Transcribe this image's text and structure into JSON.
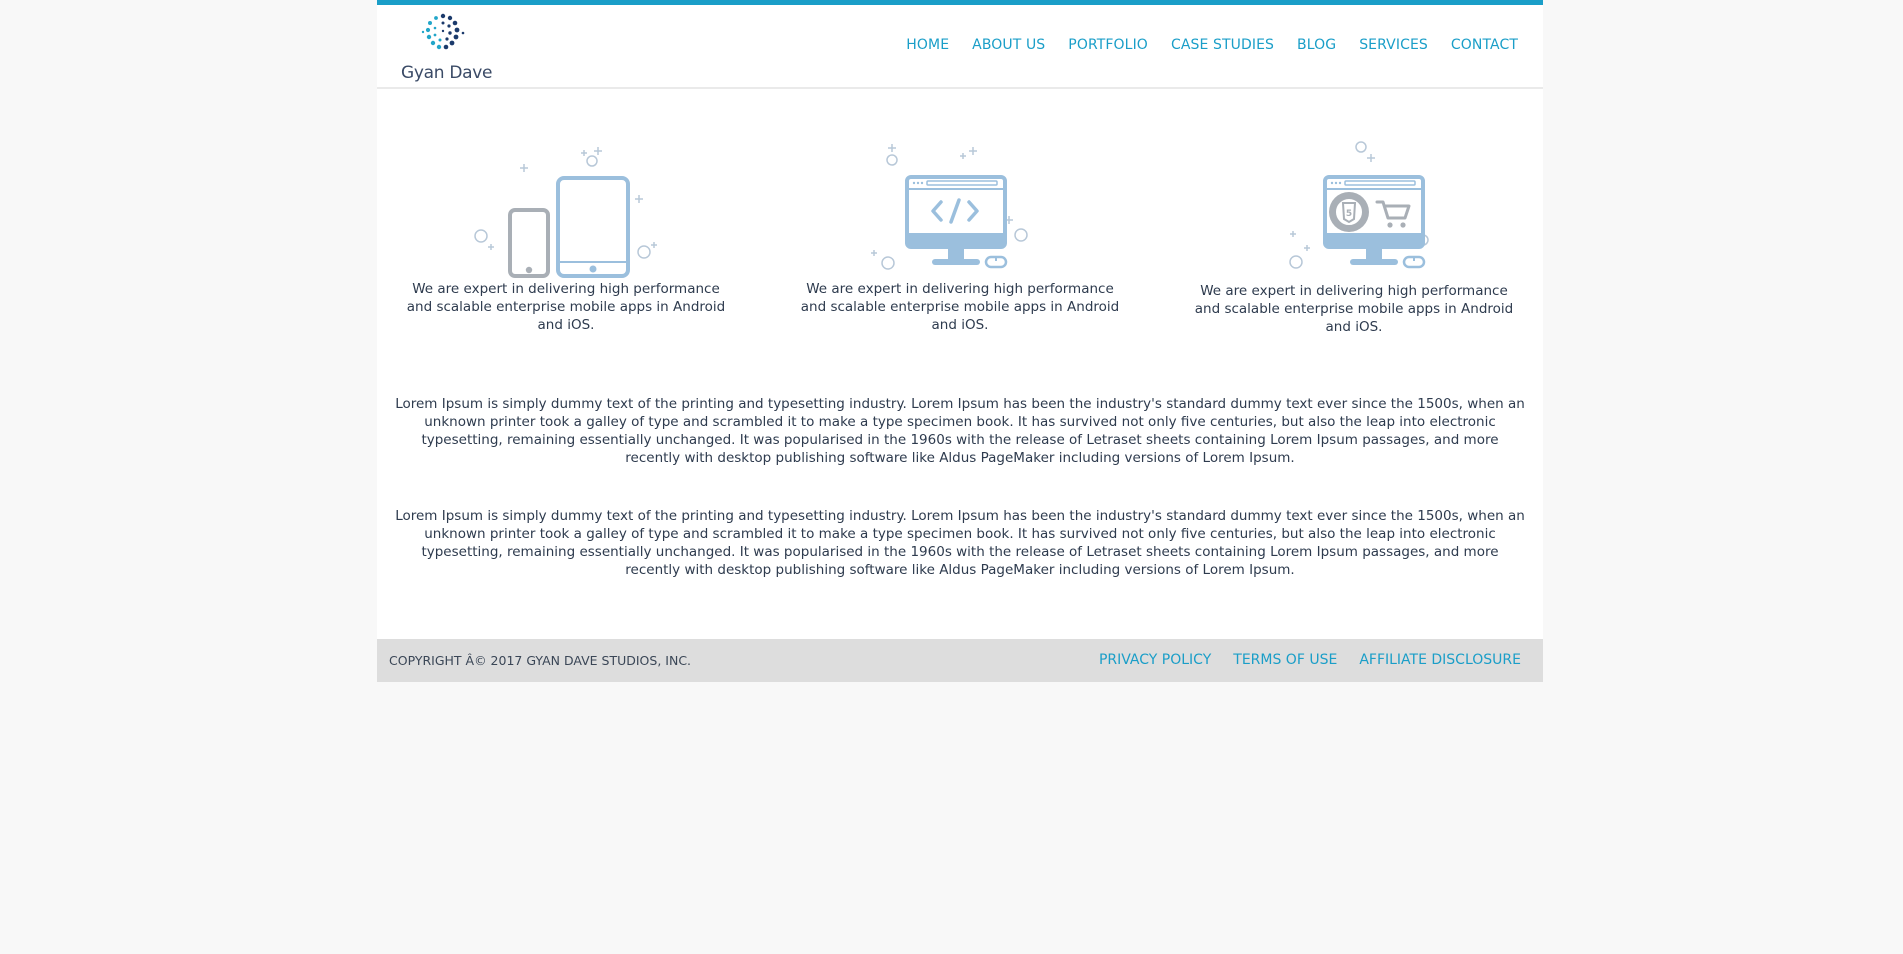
{
  "brand": {
    "name": "Gyan Dave",
    "logo_icon": "dotted-circle-logo",
    "accent_color": "#1a9ec8"
  },
  "nav": {
    "items": [
      {
        "label": "HOME"
      },
      {
        "label": "ABOUT US"
      },
      {
        "label": "PORTFOLIO"
      },
      {
        "label": "CASE STUDIES"
      },
      {
        "label": "BLOG"
      },
      {
        "label": "SERVICES"
      },
      {
        "label": "CONTACT"
      }
    ]
  },
  "features": [
    {
      "icon": "mobile-tablet-icon",
      "text": "We are expert in delivering high performance and scalable enterprise mobile apps in Android and iOS."
    },
    {
      "icon": "desktop-code-icon",
      "text": "We are expert in delivering high performance and scalable enterprise mobile apps in Android and iOS."
    },
    {
      "icon": "desktop-ecommerce-icon",
      "text": "We are expert in delivering high performance and scalable enterprise mobile apps in Android and iOS."
    }
  ],
  "paragraphs": [
    "Lorem Ipsum is simply dummy text of the printing and typesetting industry. Lorem Ipsum has been the industry's standard dummy text ever since the 1500s, when an unknown printer took a galley of type and scrambled it to make a type specimen book. It has survived not only five centuries, but also the leap into electronic typesetting, remaining essentially unchanged. It was popularised in the 1960s with the release of Letraset sheets containing Lorem Ipsum passages, and more recently with desktop publishing software like Aldus PageMaker including versions of Lorem Ipsum.",
    "Lorem Ipsum is simply dummy text of the printing and typesetting industry. Lorem Ipsum has been the industry's standard dummy text ever since the 1500s, when an unknown printer took a galley of type and scrambled it to make a type specimen book. It has survived not only five centuries, but also the leap into electronic typesetting, remaining essentially unchanged. It was popularised in the 1960s with the release of Letraset sheets containing Lorem Ipsum passages, and more recently with desktop publishing software like Aldus PageMaker including versions of Lorem Ipsum."
  ],
  "footer": {
    "copyright": "COPYRIGHT Â© 2017 GYAN DAVE STUDIOS, INC.",
    "links": [
      {
        "label": "PRIVACY POLICY"
      },
      {
        "label": "TERMS OF USE"
      },
      {
        "label": "AFFILIATE DISCLOSURE"
      }
    ]
  }
}
